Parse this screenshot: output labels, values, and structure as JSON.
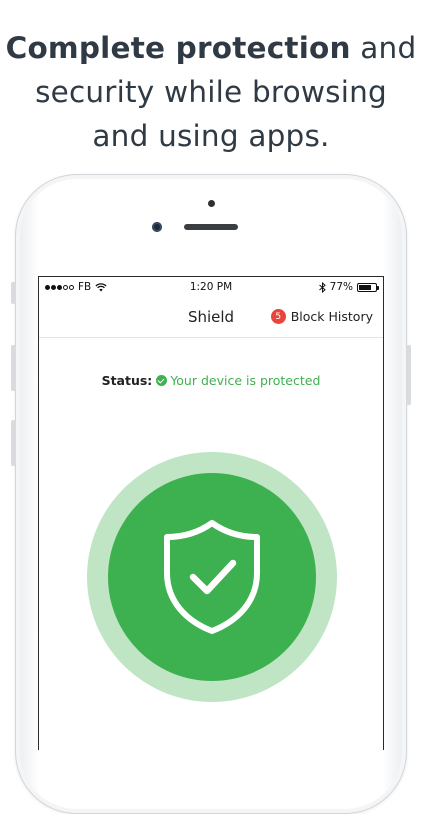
{
  "headline": {
    "bold": "Complete protection",
    "line1_rest": " and",
    "line2": "security while browsing",
    "line3": "and using apps."
  },
  "statusbar": {
    "carrier": "FB",
    "time": "1:20 PM",
    "battery": "77%",
    "battery_level": 0.77
  },
  "navbar": {
    "title": "Shield",
    "block_count": "5",
    "block_history_label": "Block History"
  },
  "status": {
    "label": "Status:",
    "value": "Your device is protected"
  },
  "colors": {
    "accent_green": "#3db14f",
    "halo_green": "#bfe5c5",
    "badge_red": "#e8453c",
    "headline_text": "#2f3a45"
  },
  "icons": {
    "shield": "shield-check-icon",
    "status_check": "check-circle-icon",
    "bluetooth": "bluetooth-icon",
    "wifi": "wifi-icon"
  }
}
